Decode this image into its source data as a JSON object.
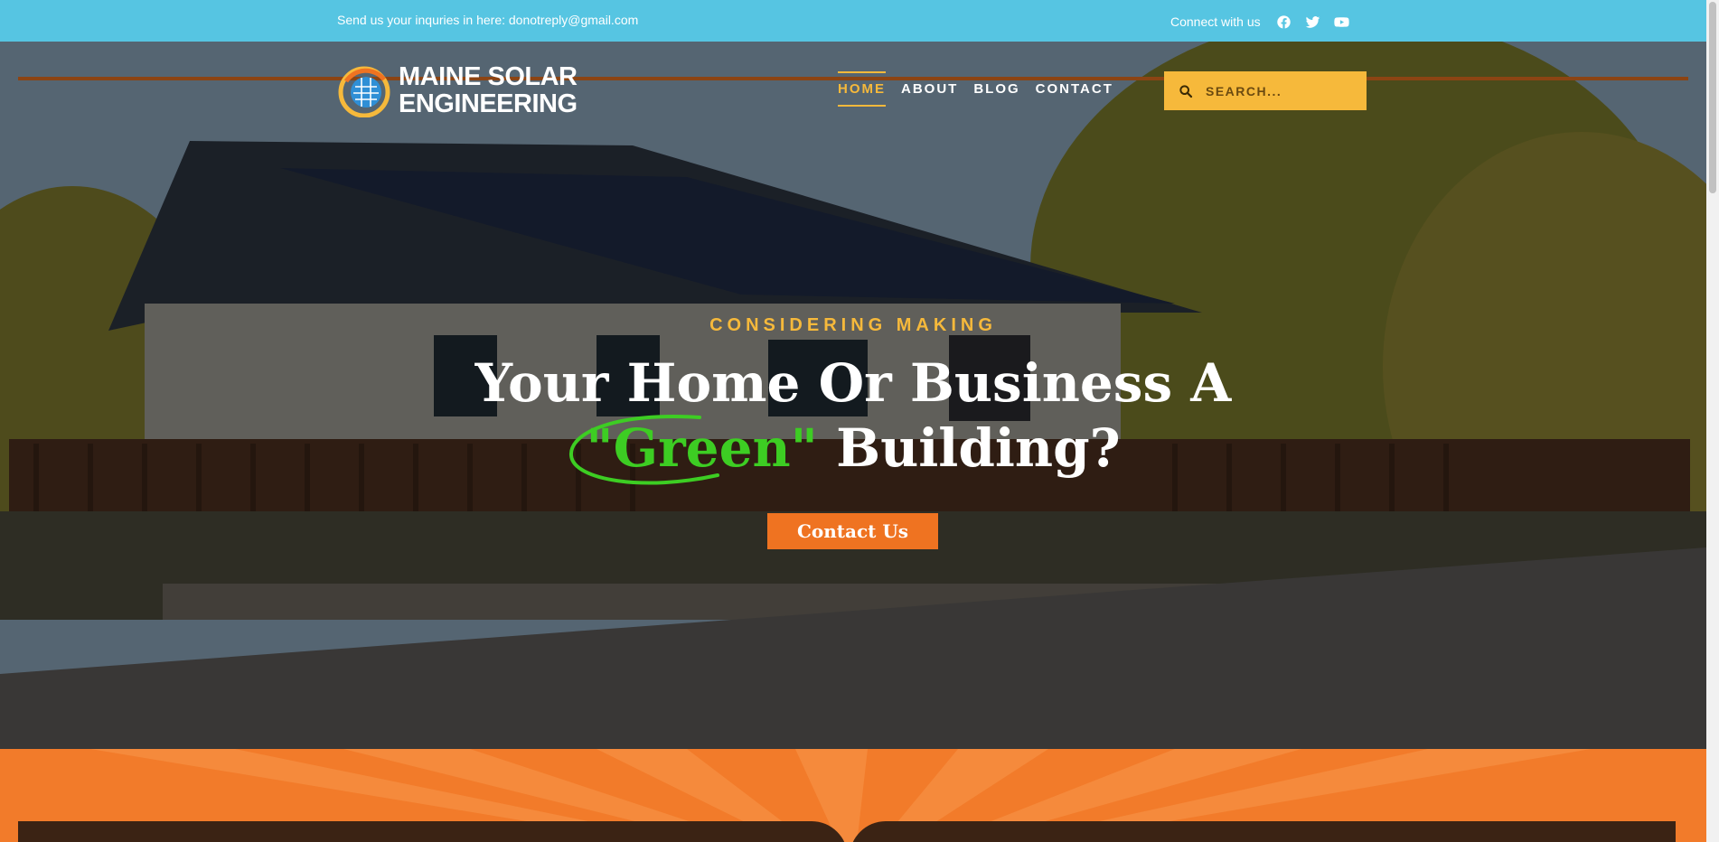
{
  "topbar": {
    "email_text": "Send us your inquries in here: donotreply@gmail.com",
    "connect_label": "Connect with us",
    "social": [
      "facebook-icon",
      "twitter-icon",
      "youtube-icon"
    ]
  },
  "header": {
    "logo_line1": "MAINE SOLAR",
    "logo_line2": "ENGINEERING",
    "menu": [
      {
        "label": "HOME",
        "active": true
      },
      {
        "label": "ABOUT",
        "active": false
      },
      {
        "label": "BLOG",
        "active": false
      },
      {
        "label": "CONTACT",
        "active": false
      }
    ],
    "search_placeholder": "SEARCH..."
  },
  "hero": {
    "eyebrow": "CONSIDERING MAKING",
    "headline_line1": "Your Home Or Business A",
    "headline_green": "\"Green\"",
    "headline_rest": " Building?",
    "cta_label": "Contact Us"
  },
  "colors": {
    "topbar": "#56c5e2",
    "accent_yellow": "#f6b93b",
    "accent_orange": "#ef7321",
    "green": "#3dcd23",
    "nav_line": "#8c4413"
  }
}
